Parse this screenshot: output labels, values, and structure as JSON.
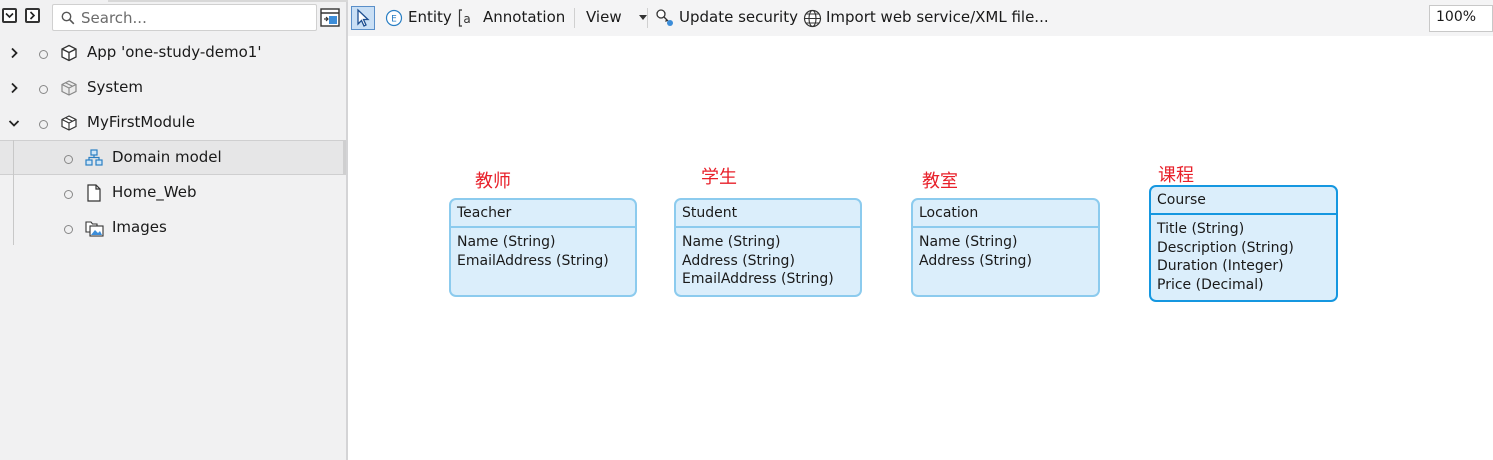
{
  "left_panel": {
    "search_placeholder": "Search...",
    "tree": [
      {
        "label": "App 'one-study-demo1'",
        "icon": "package-icon",
        "expanded": false
      },
      {
        "label": "System",
        "icon": "module-icon",
        "expanded": false
      },
      {
        "label": "MyFirstModule",
        "icon": "module-icon",
        "expanded": true
      },
      {
        "label": "Domain model",
        "icon": "domain-model-icon",
        "selected": true
      },
      {
        "label": "Home_Web",
        "icon": "page-icon"
      },
      {
        "label": "Images",
        "icon": "images-icon"
      }
    ]
  },
  "toolbar": {
    "entity_label": "Entity",
    "annotation_label": "Annotation",
    "view_label": "View",
    "update_security_label": "Update security",
    "import_label": "Import web service/XML file...",
    "zoom": "100%"
  },
  "canvas": {
    "annotations": [
      "教师",
      "学生",
      "教室",
      "课程"
    ],
    "entities": [
      {
        "name": "Teacher",
        "attributes": [
          "Name (String)",
          "EmailAddress (String)"
        ]
      },
      {
        "name": "Student",
        "attributes": [
          "Name (String)",
          "Address (String)",
          "EmailAddress (String)"
        ]
      },
      {
        "name": "Location",
        "attributes": [
          "Name (String)",
          "Address (String)"
        ]
      },
      {
        "name": "Course",
        "attributes": [
          "Title (String)",
          "Description (String)",
          "Duration (Integer)",
          "Price (Decimal)"
        ],
        "selected": true
      }
    ]
  },
  "colors": {
    "entity_fill": "#dbeefb",
    "entity_border": "#8ccbee",
    "entity_border_selected": "#1597e0",
    "annotation_text": "#e8202a"
  }
}
